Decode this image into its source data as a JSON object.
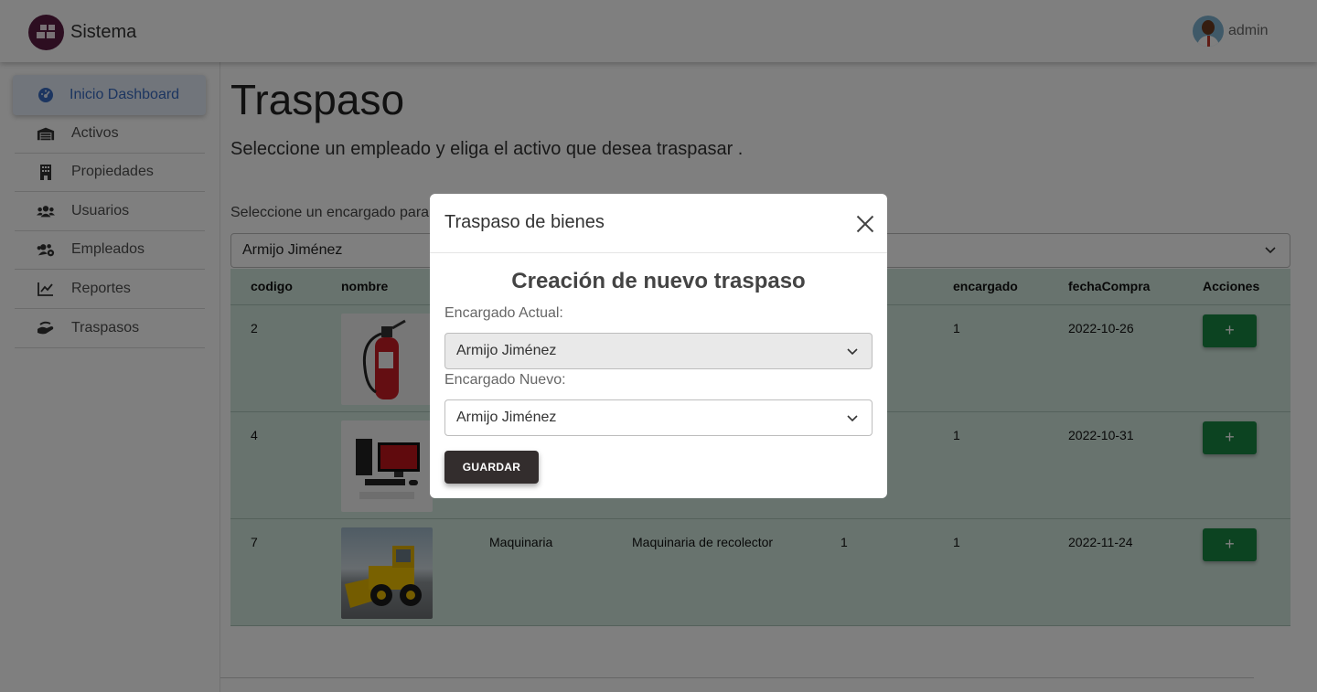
{
  "topbar": {
    "brand": "Sistema",
    "user": "admin"
  },
  "sidebar": {
    "items": [
      {
        "label": "Inicio Dashboard",
        "icon": "dashboard-icon"
      },
      {
        "label": "Activos",
        "icon": "warehouse-icon"
      },
      {
        "label": "Propiedades",
        "icon": "building-icon"
      },
      {
        "label": "Usuarios",
        "icon": "users-icon"
      },
      {
        "label": "Empleados",
        "icon": "users-gear-icon"
      },
      {
        "label": "Reportes",
        "icon": "chart-line-icon"
      },
      {
        "label": "Traspasos",
        "icon": "hand-holding-icon"
      }
    ]
  },
  "main": {
    "title": "Traspaso",
    "subtitle": "Seleccione un empleado y eliga el activo que desea traspasar .",
    "select_label": "Seleccione un encargado para",
    "select_value": "Armijo Jiménez",
    "table": {
      "headers": [
        "codigo",
        "nombre",
        "",
        "",
        "ad",
        "encargado",
        "fechaCompra",
        "Acciones"
      ],
      "rows": [
        {
          "codigo": "2",
          "categoria": "",
          "descripcion": "",
          "cantidad": "",
          "encargado": "1",
          "fecha": "2022-10-26",
          "image": "fire-extinguisher"
        },
        {
          "codigo": "4",
          "categoria": "",
          "descripcion": "",
          "cantidad": "",
          "encargado": "1",
          "fecha": "2022-10-31",
          "image": "computer-set"
        },
        {
          "codigo": "7",
          "categoria": "Maquinaria",
          "descripcion": "Maquinaria de recolector",
          "cantidad": "1",
          "encargado": "1",
          "fecha": "2022-11-24",
          "image": "front-loader"
        }
      ],
      "action_label": "+"
    }
  },
  "modal": {
    "title": "Traspaso de bienes",
    "heading": "Creación de nuevo traspaso",
    "current_label": "Encargado Actual:",
    "current_value": "Armijo Jiménez",
    "new_label": "Encargado Nuevo:",
    "new_value": "Armijo Jiménez",
    "save_label": "GUARDAR"
  },
  "colors": {
    "brand": "#5a1d43",
    "accent": "#386bc0",
    "success": "#198743",
    "table_bg": "#d1e7dd",
    "dark_button": "#332d2d"
  }
}
